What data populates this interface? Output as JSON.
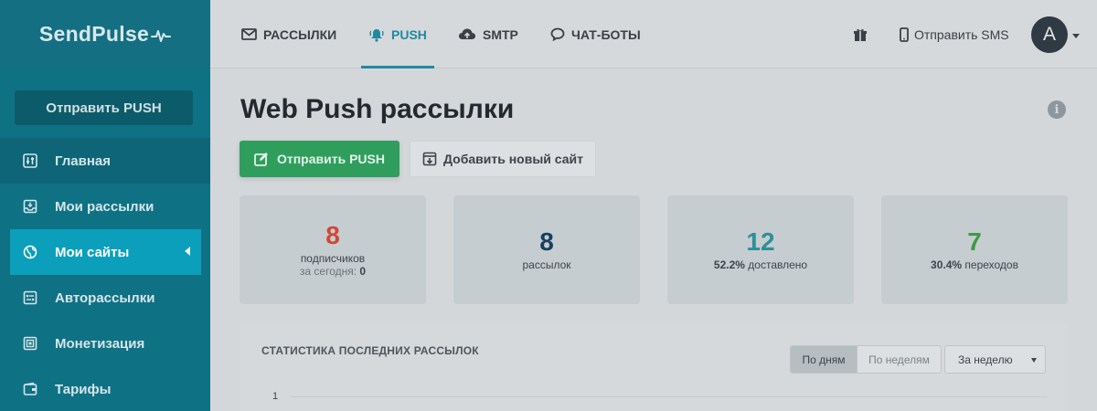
{
  "brand": {
    "name": "SendPulse"
  },
  "sidebar": {
    "send_button": "Отправить PUSH",
    "items": [
      {
        "label": "Главная",
        "icon": "sliders-icon"
      },
      {
        "label": "Мои рассылки",
        "icon": "inbox-icon"
      },
      {
        "label": "Мои сайты",
        "icon": "globe-icon",
        "active": true
      },
      {
        "label": "Авторассылки",
        "icon": "automation-icon"
      },
      {
        "label": "Монетизация",
        "icon": "monetization-icon"
      },
      {
        "label": "Тарифы",
        "icon": "wallet-icon"
      }
    ]
  },
  "topnav": {
    "tabs": [
      {
        "label": "РАССЫЛКИ",
        "icon": "envelope-icon"
      },
      {
        "label": "PUSH",
        "icon": "bell-icon",
        "active": true
      },
      {
        "label": "SMTP",
        "icon": "cloud-upload-icon"
      },
      {
        "label": "ЧАТ-БОТЫ",
        "icon": "chat-icon"
      }
    ],
    "sms_label": "Отправить SMS",
    "avatar_letter": "A"
  },
  "main": {
    "title": "Web Push рассылки",
    "send_button": "Отправить PUSH",
    "add_site_button": "Добавить новый сайт",
    "stats": [
      {
        "value": "8",
        "label": "подписчиков",
        "sub_label": "за сегодня:",
        "sub_value": "0",
        "color": "#d0473a"
      },
      {
        "value": "8",
        "label": "рассылок",
        "color": "#163f5e"
      },
      {
        "value": "12",
        "label_strong": "52.2%",
        "label": "доставлено",
        "color": "#2f8f98"
      },
      {
        "value": "7",
        "label_strong": "30.4%",
        "label": "переходов",
        "color": "#3f9944"
      }
    ],
    "panel": {
      "title": "СТАТИСТИКА ПОСЛЕДНИХ РАССЫЛОК",
      "toggle_days": "По дням",
      "toggle_weeks": "По неделям",
      "period_select": "За неделю",
      "y_tick": "1"
    }
  }
}
